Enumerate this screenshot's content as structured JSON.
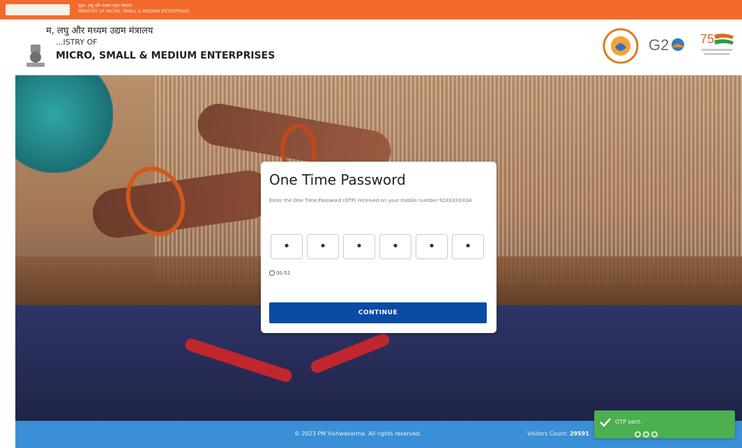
{
  "topbar": {
    "line1": "सूक्ष्म, लघु और मध्यम उद्यम मंत्रालय",
    "line2": "MINISTRY OF MICRO, SMALL & MEDIUM ENTERPRISES"
  },
  "header": {
    "ministry_hindi": "म, लघु और मध्यम उद्यम मंत्रालय",
    "ministry_of": "...ISTRY OF",
    "ministry_name": "MICRO, SMALL & MEDIUM ENTERPRISES"
  },
  "otp_card": {
    "title": "One Time Password",
    "description": "Enter the One Time Password (OTP) received on your mobile number 92XXXXXX04",
    "digits": [
      "•",
      "•",
      "•",
      "•",
      "•",
      "•"
    ],
    "timer": "00:52",
    "continue_label": "CONTINUE"
  },
  "footer": {
    "copyright": "© 2023 PM Vishwakarma. All rights reserved.",
    "visitors_label": "Visitors Count:",
    "visitors_count": "29591"
  },
  "toast": {
    "message": "OTP sent."
  },
  "colors": {
    "topbar": "#f26b2c",
    "continue_button": "#0a4ca5",
    "footer": "#3b8fd6",
    "toast": "#4caf50"
  }
}
